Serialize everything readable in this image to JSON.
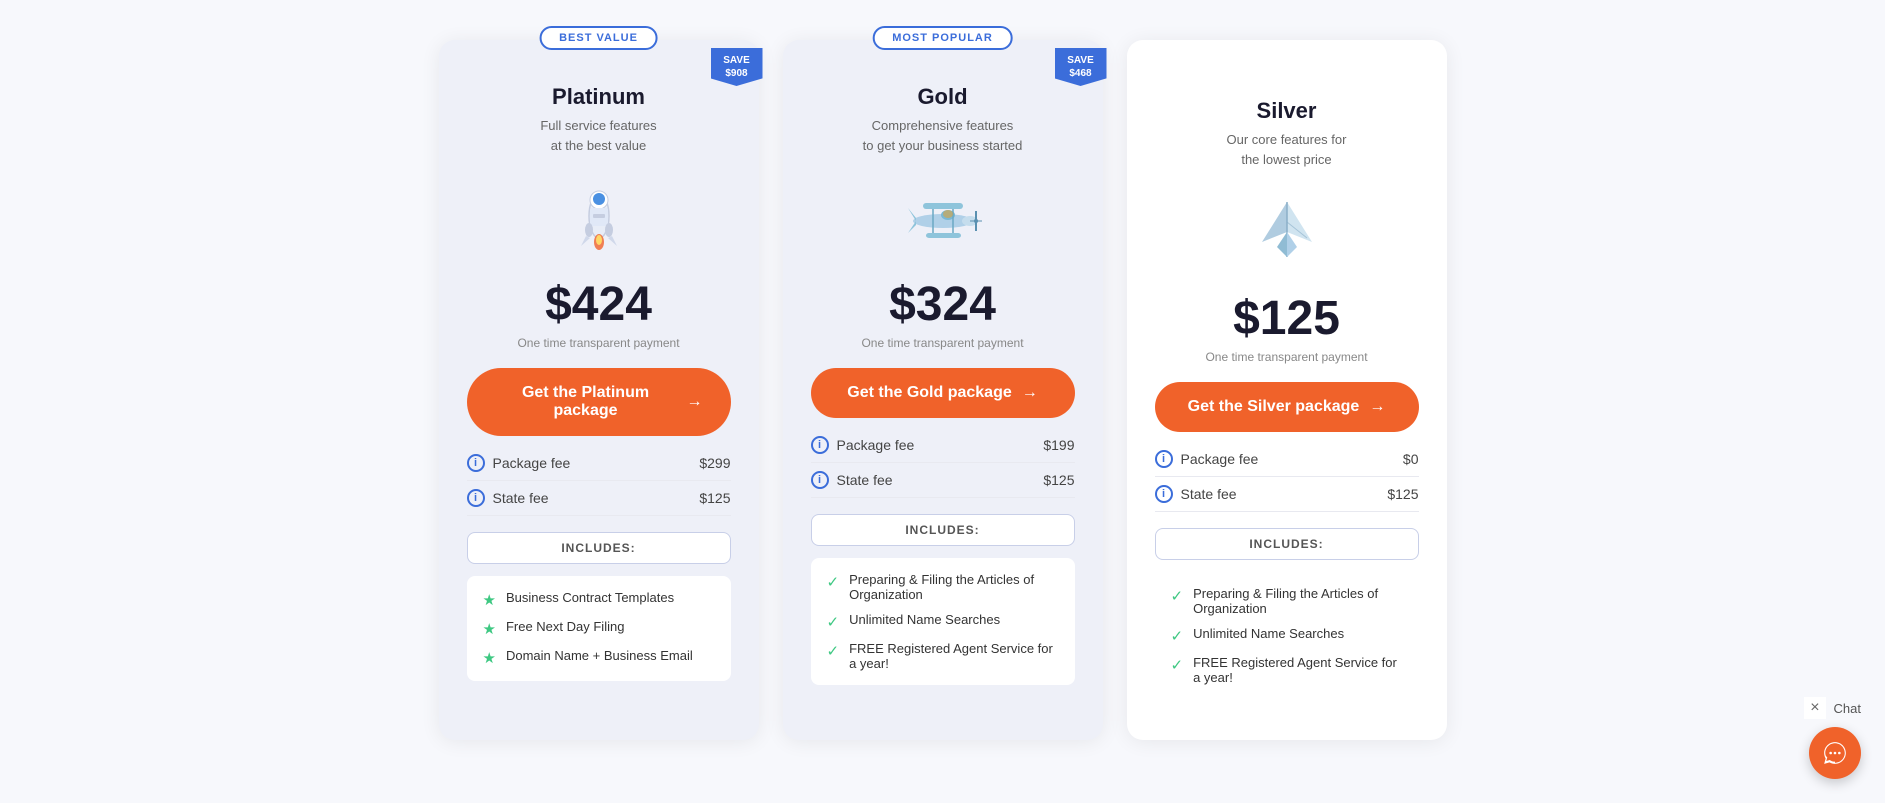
{
  "page": {
    "background": "#f7f8fc"
  },
  "platinum": {
    "badge": "BEST VALUE",
    "save_ribbon_line1": "SAVE",
    "save_ribbon_line2": "$908",
    "title": "Platinum",
    "subtitle_line1": "Full service features",
    "subtitle_line2": "at the best value",
    "price": "$424",
    "price_sub": "One time transparent payment",
    "cta": "Get the Platinum package",
    "cta_arrow": "→",
    "package_fee_label": "Package fee",
    "package_fee_value": "$299",
    "state_fee_label": "State fee",
    "state_fee_value": "$125",
    "includes_label": "INCLUDES:",
    "features": [
      "Business Contract Templates",
      "Free Next Day Filing",
      "Domain Name + Business Email"
    ]
  },
  "gold": {
    "badge": "MOST POPULAR",
    "save_ribbon_line1": "SAVE",
    "save_ribbon_line2": "$468",
    "title": "Gold",
    "subtitle_line1": "Comprehensive features",
    "subtitle_line2": "to get your business started",
    "price": "$324",
    "price_sub": "One time transparent payment",
    "cta": "Get the Gold package",
    "cta_arrow": "→",
    "package_fee_label": "Package fee",
    "package_fee_value": "$199",
    "state_fee_label": "State fee",
    "state_fee_value": "$125",
    "includes_label": "INCLUDES:",
    "features": [
      "Preparing & Filing the Articles of Organization",
      "Unlimited Name Searches",
      "FREE Registered Agent Service for a year!"
    ]
  },
  "silver": {
    "title": "Silver",
    "subtitle_line1": "Our core features for",
    "subtitle_line2": "the lowest price",
    "price": "$125",
    "price_sub": "One time transparent payment",
    "cta": "Get the Silver package",
    "cta_arrow": "→",
    "package_fee_label": "Package fee",
    "package_fee_value": "$0",
    "state_fee_label": "State fee",
    "state_fee_value": "$125",
    "includes_label": "INCLUDES:",
    "features": [
      "Preparing & Filing the Articles of Organization",
      "Unlimited Name Searches",
      "FREE Registered Agent Service for a year!"
    ]
  },
  "chat": {
    "close_label": "×",
    "label": "Chat"
  }
}
